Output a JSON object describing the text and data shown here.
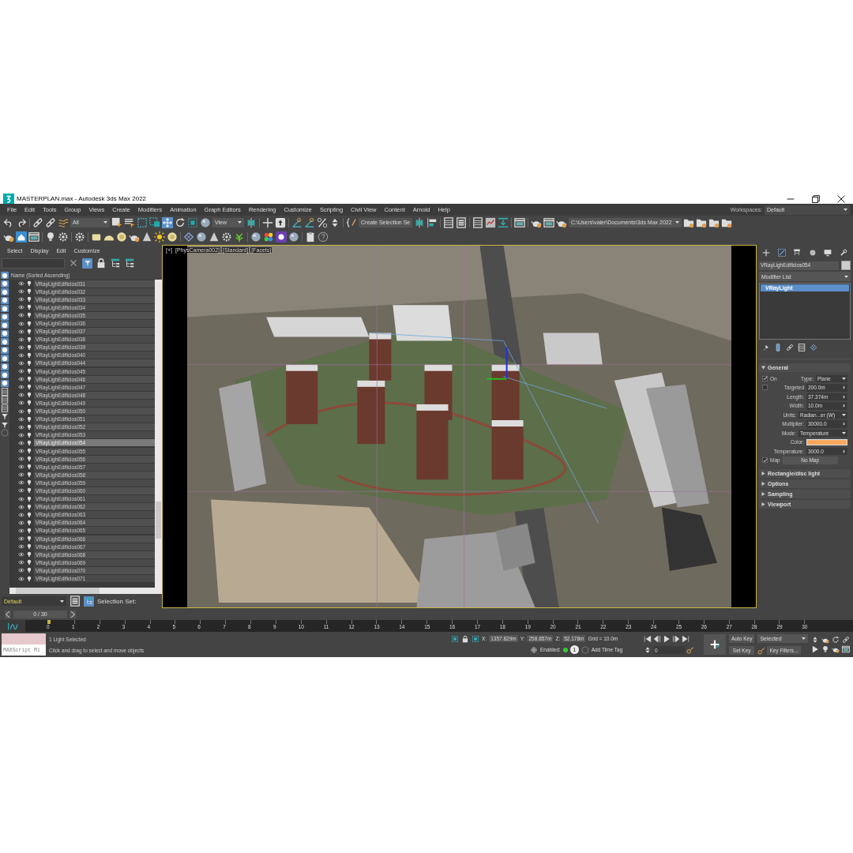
{
  "window": {
    "title": "MASTERPLAN.max - Autodesk 3ds Max 2022"
  },
  "menu": [
    "File",
    "Edit",
    "Tools",
    "Group",
    "Views",
    "Create",
    "Modifiers",
    "Animation",
    "Graph Editors",
    "Rendering",
    "Customize",
    "Scripting",
    "Civil View",
    "Content",
    "Arnold",
    "Help"
  ],
  "workspaces": {
    "label": "Workspaces:",
    "value": "Default"
  },
  "toolbar": {
    "selection_filter": "All",
    "reference_coordinate": "View",
    "selection_set": "Create Selection Se",
    "project_path": "C:\\Users\\valer\\Documents\\3ds Max 2022"
  },
  "scene_explorer": {
    "menu": [
      "Select",
      "Display",
      "Edit",
      "Customize"
    ],
    "column_header": "Name (Sorted Ascending)",
    "rows": [
      {
        "name": "VRayLighEdificios031",
        "selected": false
      },
      {
        "name": "VRayLighEdificios032",
        "selected": false
      },
      {
        "name": "VRayLighEdificios033",
        "selected": false
      },
      {
        "name": "VRayLighEdificios034",
        "selected": false
      },
      {
        "name": "VRayLighEdificios035",
        "selected": false
      },
      {
        "name": "VRayLighEdificios036",
        "selected": false
      },
      {
        "name": "VRayLighEdificios037",
        "selected": false
      },
      {
        "name": "VRayLighEdificios038",
        "selected": false
      },
      {
        "name": "VRayLighEdificios039",
        "selected": false
      },
      {
        "name": "VRayLighEdificios040",
        "selected": false
      },
      {
        "name": "VRayLighEdificios044",
        "selected": false
      },
      {
        "name": "VRayLighEdificios045",
        "selected": false
      },
      {
        "name": "VRayLighEdificios046",
        "selected": false
      },
      {
        "name": "VRayLighEdificios047",
        "selected": false
      },
      {
        "name": "VRayLighEdificios048",
        "selected": false
      },
      {
        "name": "VRayLighEdificios049",
        "selected": false
      },
      {
        "name": "VRayLighEdificios050",
        "selected": false
      },
      {
        "name": "VRayLighEdificios051",
        "selected": false
      },
      {
        "name": "VRayLighEdificios052",
        "selected": false
      },
      {
        "name": "VRayLighEdificios053",
        "selected": false
      },
      {
        "name": "VRayLighEdificios054",
        "selected": true
      },
      {
        "name": "VRayLighEdificios055",
        "selected": false
      },
      {
        "name": "VRayLighEdificios056",
        "selected": false
      },
      {
        "name": "VRayLighEdificios057",
        "selected": false
      },
      {
        "name": "VRayLighEdificios058",
        "selected": false
      },
      {
        "name": "VRayLighEdificios059",
        "selected": false
      },
      {
        "name": "VRayLighEdificios060",
        "selected": false
      },
      {
        "name": "VRayLighEdificios061",
        "selected": false
      },
      {
        "name": "VRayLighEdificios062",
        "selected": false
      },
      {
        "name": "VRayLighEdificios063",
        "selected": false
      },
      {
        "name": "VRayLighEdificios064",
        "selected": false
      },
      {
        "name": "VRayLighEdificios065",
        "selected": false
      },
      {
        "name": "VRayLighEdificios066",
        "selected": false
      },
      {
        "name": "VRayLighEdificios067",
        "selected": false
      },
      {
        "name": "VRayLighEdificios068",
        "selected": false
      },
      {
        "name": "VRayLighEdificios069",
        "selected": false
      },
      {
        "name": "VRayLighEdificios070",
        "selected": false
      },
      {
        "name": "VRayLighEdificios071",
        "selected": false
      }
    ],
    "layer": "Default",
    "selection_set_label": "Selection Set:"
  },
  "viewport": {
    "labels": [
      "[+]",
      "[PhysCamera002]",
      "[Standard]",
      "[Facets]"
    ]
  },
  "command_panel": {
    "object_name": "VRayLighEdificios054",
    "modifier_list": "Modifier List",
    "modifier_stack": [
      {
        "name": "VRayLight",
        "selected": true
      }
    ],
    "rollouts": [
      {
        "title": "General",
        "expanded": true
      },
      {
        "title": "Rectangle/disc light",
        "expanded": false
      },
      {
        "title": "Options",
        "expanded": false
      },
      {
        "title": "Sampling",
        "expanded": false
      },
      {
        "title": "Viewport",
        "expanded": false
      }
    ],
    "general": [
      {
        "kind": "check-dropdown",
        "label": "On",
        "checked": true,
        "field_label": "Type:",
        "value": "Plane"
      },
      {
        "kind": "check-spinner",
        "label": "Targeted",
        "checked": false,
        "value": "200.0m"
      },
      {
        "kind": "spinner",
        "label": "Length:",
        "value": "37.374m"
      },
      {
        "kind": "spinner",
        "label": "Width:",
        "value": "10.0m"
      },
      {
        "kind": "dropdown",
        "label": "Units:",
        "value": "Radian...er (W)"
      },
      {
        "kind": "spinner",
        "label": "Multiplier:",
        "value": "30000.0"
      },
      {
        "kind": "dropdown",
        "label": "Mode:",
        "value": "Temperature"
      },
      {
        "kind": "color",
        "label": "Color:",
        "color": "#f7a95e"
      },
      {
        "kind": "spinner",
        "label": "Temperature:",
        "value": "3000.0"
      },
      {
        "kind": "check-button",
        "label": "Map",
        "checked": true,
        "value": "No Map"
      }
    ]
  },
  "timeline": {
    "frame": "0 / 30",
    "level": 0,
    "ticks": [
      "0",
      "1",
      "2",
      "3",
      "4",
      "5",
      "6",
      "7",
      "8",
      "9",
      "10",
      "11",
      "12",
      "13",
      "14",
      "15",
      "16",
      "17",
      "18",
      "19",
      "20",
      "21",
      "22",
      "23",
      "24",
      "25",
      "26",
      "27",
      "28",
      "29",
      "30"
    ]
  },
  "status": {
    "maxscript": "MAXScript Mi",
    "selection": "1 Light Selected",
    "prompt": "Click and drag to select and move objects",
    "coords": [
      {
        "label": "X:",
        "value": "1357.829m"
      },
      {
        "label": "Y:",
        "value": "258.857m"
      },
      {
        "label": "Z:",
        "value": "52.178m"
      }
    ],
    "grid": "Grid = 10.0m",
    "enabled_label": "Enabled:",
    "enabled_count": "1",
    "add_time_tag": "Add Time Tag",
    "frame_field": "0",
    "auto_key": "Auto Key",
    "key_mode": "Selected",
    "set_key": "Set Key",
    "key_filters": "Key Filters..."
  }
}
